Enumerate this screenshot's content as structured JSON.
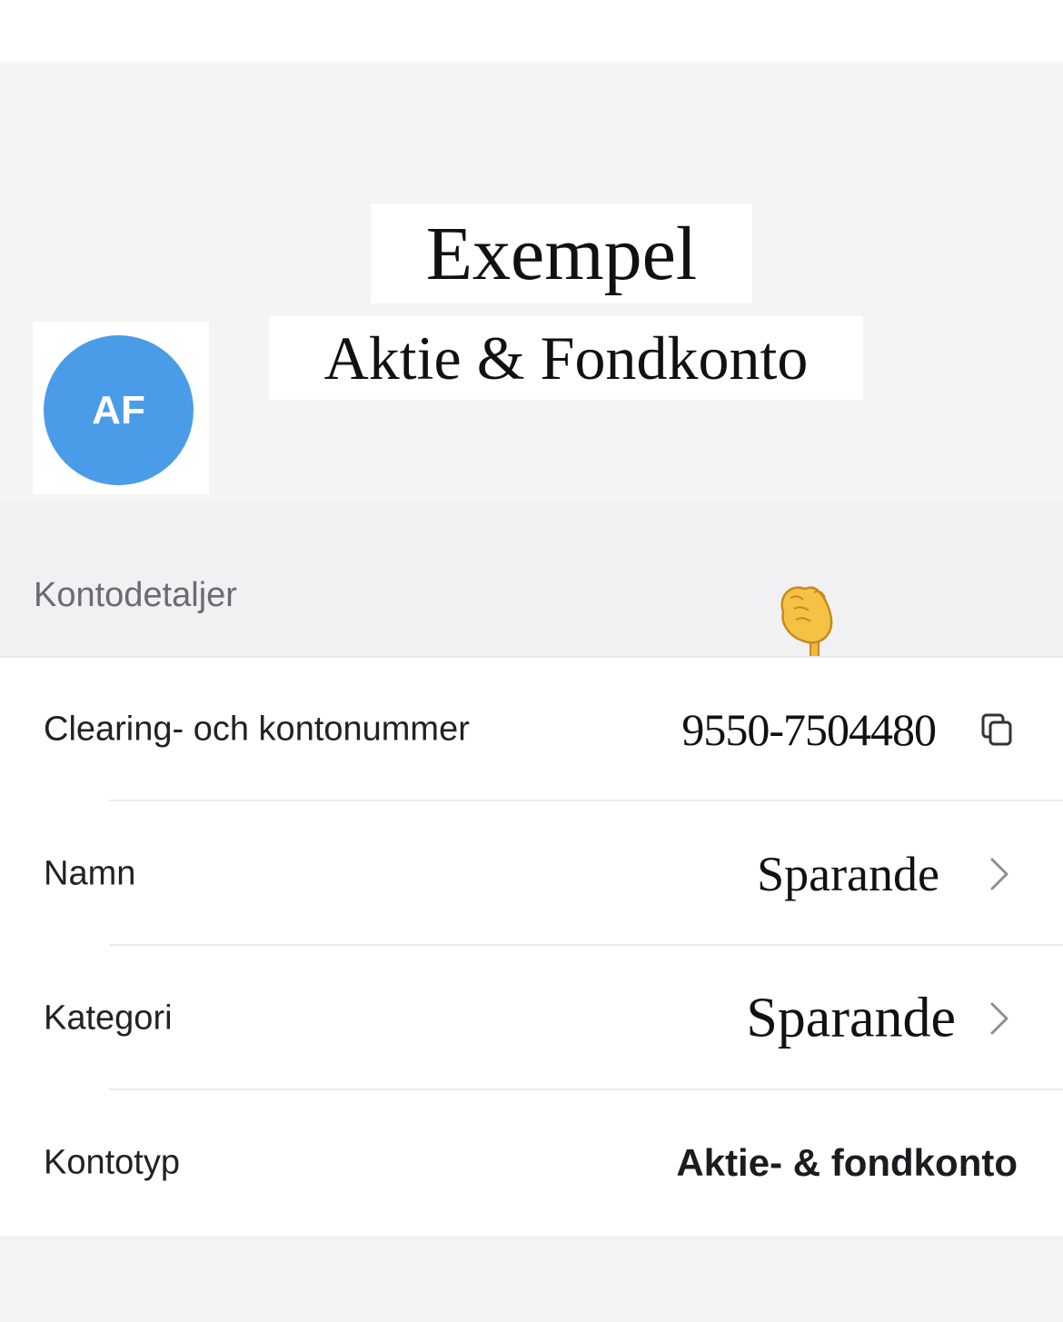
{
  "header": {
    "title": "Exempel",
    "subtitle": "Aktie & Fondkonto",
    "avatar_initials": "AF",
    "avatar_color": "#4b9ce8"
  },
  "section": {
    "title": "Kontodetaljer",
    "pointer_icon": "backhand-index-pointing-down-icon"
  },
  "rows": [
    {
      "label": "Clearing- och kontonummer",
      "value": "9550-7504480",
      "icon": "copy-icon"
    },
    {
      "label": "Namn",
      "value": "Sparande",
      "icon": "chevron-right-icon"
    },
    {
      "label": "Kategori",
      "value": "Sparande",
      "icon": "chevron-right-icon"
    },
    {
      "label": "Kontotyp",
      "value": "Aktie- & fondkonto"
    }
  ]
}
